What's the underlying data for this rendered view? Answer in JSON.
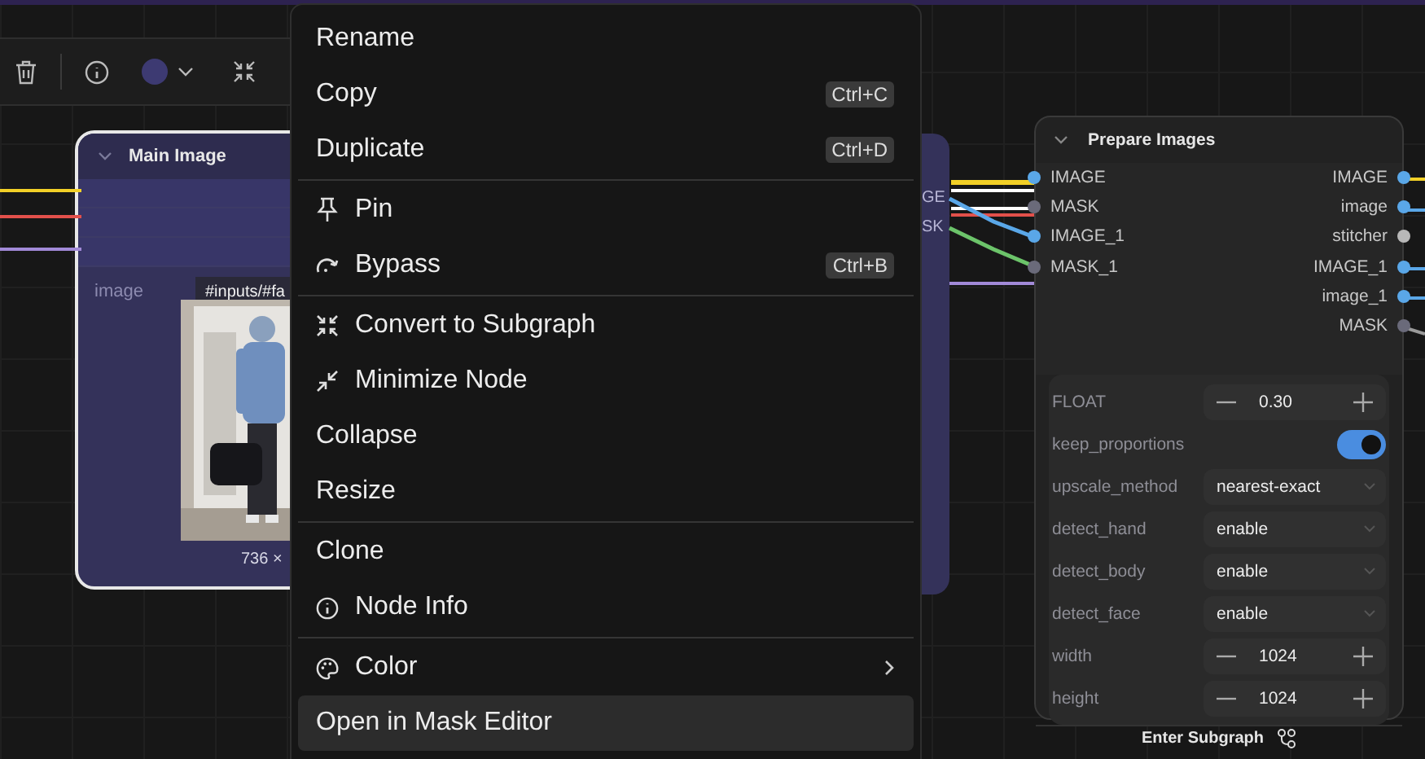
{
  "main_node": {
    "title": "Main Image",
    "widget_label": "image",
    "widget_value": "#inputs/#fa",
    "image_size": "736 ×"
  },
  "background_node": {
    "outputs": [
      "GE",
      "SK"
    ]
  },
  "prepare_node": {
    "title": "Prepare Images",
    "inputs": [
      {
        "label": "IMAGE",
        "color": "#5aa7e8"
      },
      {
        "label": "MASK",
        "color": "#6a6a7a"
      },
      {
        "label": "IMAGE_1",
        "color": "#5aa7e8"
      },
      {
        "label": "MASK_1",
        "color": "#6a6a7a"
      }
    ],
    "outputs": [
      {
        "label": "IMAGE",
        "color": "#5aa7e8"
      },
      {
        "label": "image",
        "color": "#5aa7e8"
      },
      {
        "label": "stitcher",
        "color": "#b8b8b8"
      },
      {
        "label": "IMAGE_1",
        "color": "#5aa7e8"
      },
      {
        "label": "image_1",
        "color": "#5aa7e8"
      },
      {
        "label": "MASK",
        "color": "#6a6a7a"
      }
    ],
    "widgets": [
      {
        "kind": "number",
        "label": "FLOAT",
        "value": "0.30"
      },
      {
        "kind": "toggle",
        "label": "keep_proportions",
        "on": true
      },
      {
        "kind": "combo",
        "label": "upscale_method",
        "value": "nearest-exact"
      },
      {
        "kind": "combo",
        "label": "detect_hand",
        "value": "enable"
      },
      {
        "kind": "combo",
        "label": "detect_body",
        "value": "enable"
      },
      {
        "kind": "combo",
        "label": "detect_face",
        "value": "enable"
      },
      {
        "kind": "number",
        "label": "width",
        "value": "1024"
      },
      {
        "kind": "number",
        "label": "height",
        "value": "1024"
      }
    ],
    "footer_button": "Enter Subgraph"
  },
  "context_menu": {
    "groups": [
      [
        {
          "label": "Rename",
          "has_icon": false,
          "selected": false
        },
        {
          "label": "Copy",
          "shortcut": "Ctrl+C",
          "has_icon": false,
          "selected": false
        },
        {
          "label": "Duplicate",
          "shortcut": "Ctrl+D",
          "has_icon": false,
          "selected": false
        }
      ],
      [
        {
          "label": "Pin",
          "has_icon": true,
          "selected": false
        },
        {
          "label": "Bypass",
          "shortcut": "Ctrl+B",
          "has_icon": true,
          "selected": false
        }
      ],
      [
        {
          "label": "Convert to Subgraph",
          "has_icon": true,
          "selected": false
        },
        {
          "label": "Minimize Node",
          "has_icon": true,
          "selected": false
        },
        {
          "label": "Collapse",
          "has_icon": false,
          "selected": false
        },
        {
          "label": "Resize",
          "has_icon": false,
          "selected": false
        }
      ],
      [
        {
          "label": "Clone",
          "has_icon": false,
          "selected": false
        },
        {
          "label": "Node Info",
          "has_icon": true,
          "selected": false
        }
      ],
      [
        {
          "label": "Color",
          "has_icon": true,
          "submenu": true,
          "selected": false
        },
        {
          "label": "Open in Mask Editor",
          "has_icon": false,
          "selected": true
        }
      ]
    ]
  }
}
